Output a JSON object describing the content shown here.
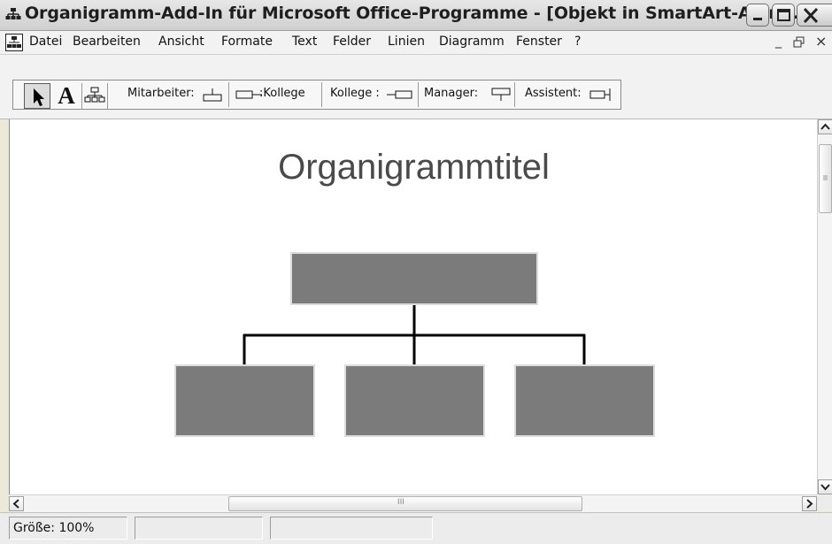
{
  "window": {
    "title": "Organigramm-Add-In für Microsoft Office-Programme - [Objekt in SmartArt-Anim..."
  },
  "menu": {
    "items": [
      "Datei",
      "Bearbeiten",
      "Ansicht",
      "Formate",
      "Text",
      "Felder",
      "Linien",
      "Diagramm",
      "Fenster",
      "?"
    ],
    "mdi_minimize": "_",
    "mdi_close": "×"
  },
  "toolbar": {
    "text_tool": "A",
    "buttons": [
      "Mitarbeiter:",
      ":Kollege",
      "Kollege :",
      "Manager:",
      "Assistent:"
    ]
  },
  "chart": {
    "title": "Organigrammtitel",
    "box_color": "#7b7b7b",
    "line_color": "#000000"
  },
  "scroll": {
    "grip": "III"
  },
  "status": {
    "size": "Größe: 100%"
  },
  "icons": [
    "org-chart-icon",
    "arrow-pointer-icon",
    "hierarchy-icon",
    "window-minimize-icon",
    "window-maximize-icon",
    "window-close-icon",
    "scroll-up-icon",
    "scroll-down-icon",
    "scroll-left-icon",
    "scroll-right-icon"
  ]
}
